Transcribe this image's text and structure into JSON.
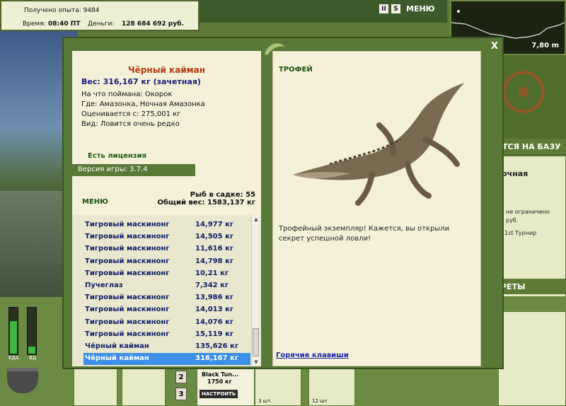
{
  "hud": {
    "experience": "Получено опыта: 9484",
    "time_label": "Время:",
    "time_value": "08:40 ПТ",
    "money_label": "Деньги:",
    "money_value": "128 684 692 руб.",
    "menu_label": "МЕНЮ",
    "icon_pause": "II",
    "icon_s": "S",
    "depth": "7,80 m"
  },
  "dialog": {
    "close": "X",
    "fish_name": "Чёрный кайман",
    "fish_weight": "Вес: 316,167 кг (зачетная)",
    "bait": "На что поймана: Окорок",
    "location": "Где: Амазонка, Ночная Амазонка",
    "valued_from": "Оценивается с: 275,001 кг",
    "rarity": "Вид: Ловится очень редко",
    "license": "Есть лицензия",
    "version": "Версия игры: 3.7.4",
    "menu_link": "МЕНЮ",
    "fish_count": "Рыб в садке: 55",
    "total_weight": "Общий вес: 1583,137 кг",
    "trophy_label": "ТРОФЕЙ",
    "trophy_text": "Трофейный экземпляр! Кажется, вы открыли секрет успешной ловли!",
    "hotkeys": "Горячие клавиши",
    "catches": [
      {
        "name": "Тигровый маскинонг",
        "weight": "14,977 кг"
      },
      {
        "name": "Тигровый маскинонг",
        "weight": "14,505 кг"
      },
      {
        "name": "Тигровый маскинонг",
        "weight": "11,616 кг"
      },
      {
        "name": "Тигровый маскинонг",
        "weight": "14,798 кг"
      },
      {
        "name": "Тигровый маскинонг",
        "weight": "10,21 кг"
      },
      {
        "name": "Пучеглаз",
        "weight": "7,342 кг"
      },
      {
        "name": "Тигровый маскинонг",
        "weight": "13,986 кг"
      },
      {
        "name": "Тигровый маскинонг",
        "weight": "14,013 кг"
      },
      {
        "name": "Тигровый маскинонг",
        "weight": "14,076 кг"
      },
      {
        "name": "Тигровый маскинонг",
        "weight": "15,119 кг"
      },
      {
        "name": "Чёрный кайман",
        "weight": "135,626 кг"
      },
      {
        "name": "Чёрный кайман",
        "weight": "316,167 кг"
      }
    ]
  },
  "background": {
    "base_header": "ТСЯ НА БАЗУ",
    "right_title": "очная",
    "right_line1": "не ограничено",
    "right_line2": "руб.",
    "right_line3": "1st Турнир",
    "section2": "РЕТЫ",
    "food_label": "ЕДА",
    "water_label": "ВД",
    "slot_num_2": "2",
    "slot_num_3": "3",
    "rod_name": "Black Tun...",
    "rod_weight": "1750 кг",
    "rod_setup": "НАСТРОИТЬ",
    "count1": "3 шт.",
    "count2": "12 шт."
  }
}
